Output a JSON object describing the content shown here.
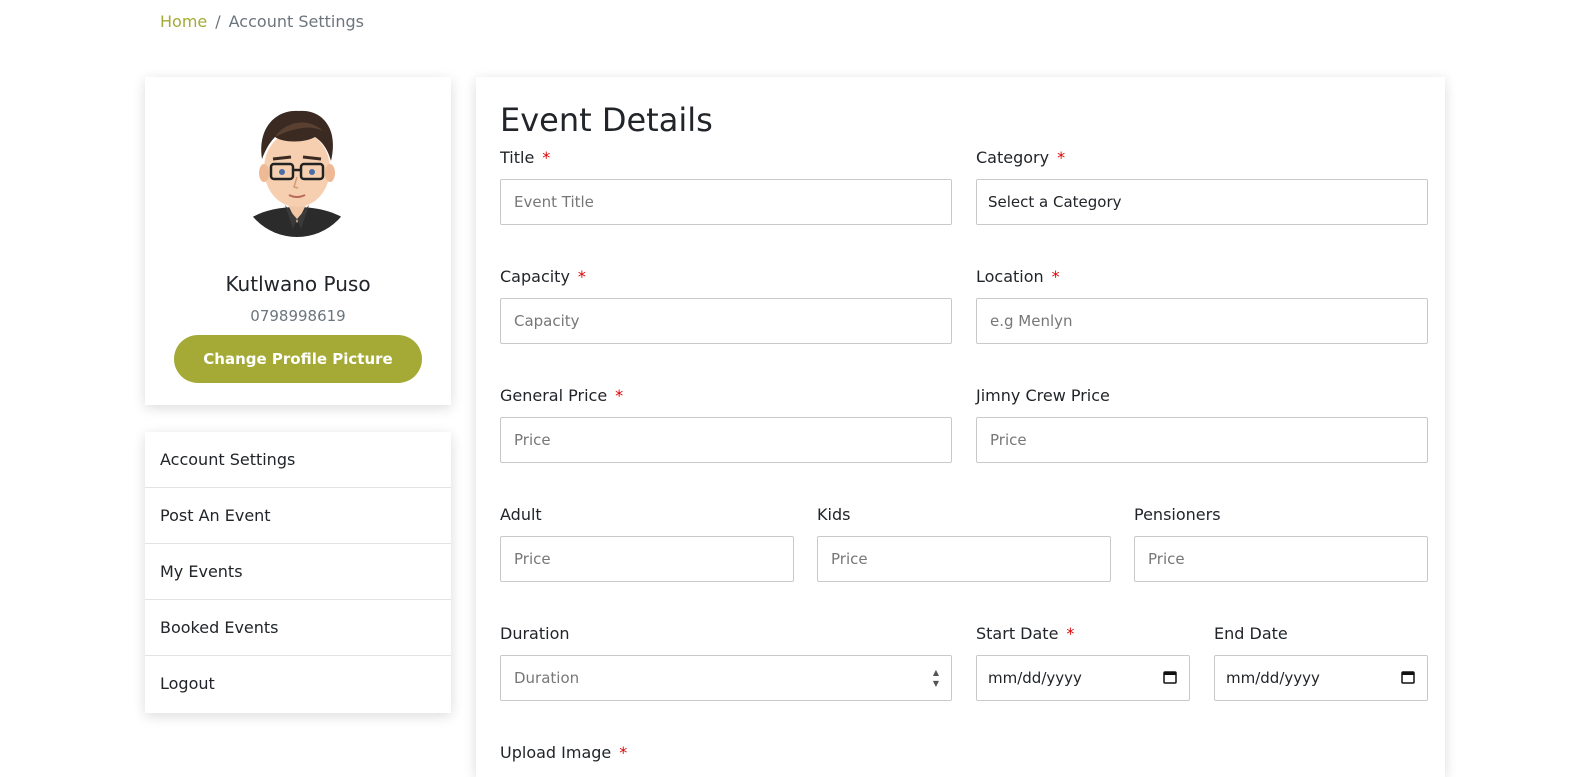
{
  "breadcrumb": {
    "home": "Home",
    "separator": "/",
    "current": "Account Settings"
  },
  "profile": {
    "name": "Kutlwano Puso",
    "phone": "0798998619",
    "change_picture_label": "Change Profile Picture"
  },
  "menu": {
    "items": [
      {
        "label": "Account Settings"
      },
      {
        "label": "Post An Event"
      },
      {
        "label": "My Events"
      },
      {
        "label": "Booked Events"
      },
      {
        "label": "Logout"
      }
    ]
  },
  "form": {
    "title": "Event Details",
    "required_marker": "*",
    "fields": {
      "title": {
        "label": "Title",
        "placeholder": "Event Title"
      },
      "category": {
        "label": "Category",
        "value": "Select a Category"
      },
      "capacity": {
        "label": "Capacity",
        "placeholder": "Capacity"
      },
      "location": {
        "label": "Location",
        "placeholder": "e.g Menlyn"
      },
      "general_price": {
        "label": "General Price",
        "placeholder": "Price"
      },
      "jimny_crew_price": {
        "label": "Jimny Crew Price",
        "placeholder": "Price"
      },
      "adult": {
        "label": "Adult",
        "placeholder": "Price"
      },
      "kids": {
        "label": "Kids",
        "placeholder": "Price"
      },
      "pensioners": {
        "label": "Pensioners",
        "placeholder": "Price"
      },
      "duration": {
        "label": "Duration",
        "placeholder": "Duration"
      },
      "start_date": {
        "label": "Start Date",
        "value": "mm/dd/yyyy"
      },
      "end_date": {
        "label": "End Date",
        "value": "mm/dd/yyyy"
      },
      "upload_image": {
        "label": "Upload Image"
      }
    }
  },
  "colors": {
    "accent": "#a4aa35",
    "required": "#e00000",
    "border": "#c9c9c9"
  }
}
